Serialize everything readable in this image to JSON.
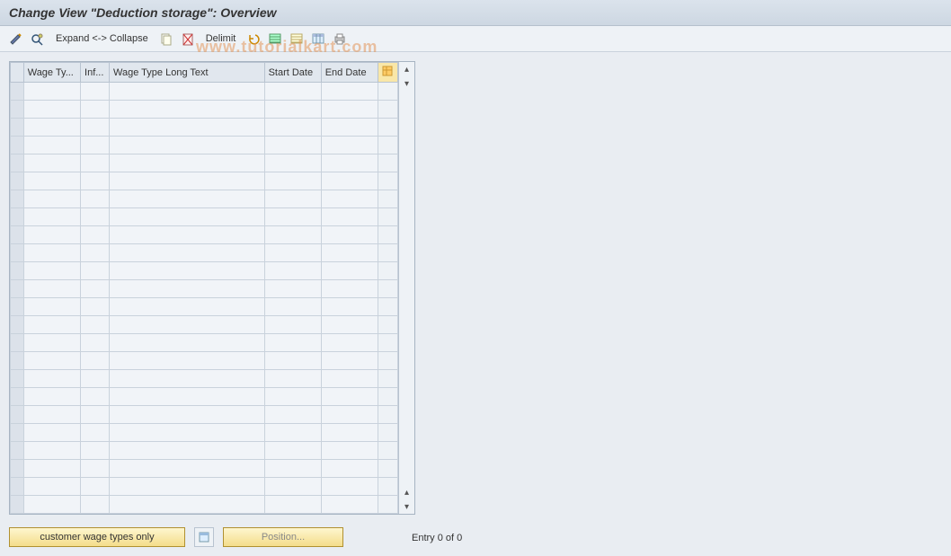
{
  "title": "Change View \"Deduction storage\": Overview",
  "toolbar": {
    "expand_collapse": "Expand <-> Collapse",
    "delimit": "Delimit"
  },
  "table": {
    "headers": {
      "wage_type": "Wage Ty...",
      "inf": "Inf...",
      "long_text": "Wage Type Long Text",
      "start_date": "Start Date",
      "end_date": "End Date"
    },
    "row_count": 24
  },
  "footer": {
    "customer_btn": "customer wage types only",
    "position_btn": "Position...",
    "entry_label": "Entry 0 of 0"
  },
  "watermark": "www.tutorialkart.com"
}
